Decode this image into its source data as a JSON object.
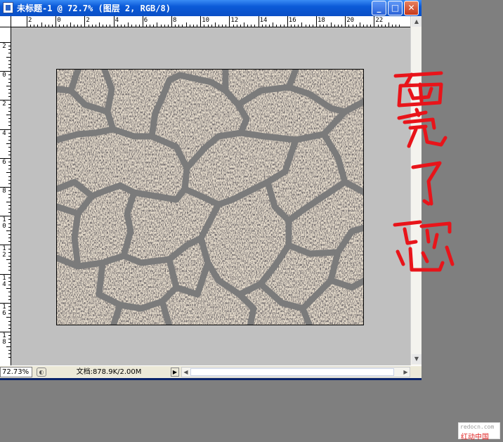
{
  "window": {
    "title": "未标题-1 @ 72.7% (图层 2, RGB/8)",
    "controls": {
      "minimize": "_",
      "maximize": "□",
      "close": "✕"
    }
  },
  "ruler_top": {
    "labels": [
      "2",
      "0",
      "2",
      "4",
      "6",
      "8",
      "10",
      "12",
      "14",
      "16",
      "18",
      "20",
      "22"
    ]
  },
  "ruler_left": {
    "labels": [
      "2",
      "0",
      "2",
      "4",
      "6",
      "8",
      "1\n0",
      "1\n2",
      "1\n4",
      "1\n6",
      "1\n8"
    ]
  },
  "status": {
    "zoom": "72.73%",
    "doc_info": "文档:878.9K/2.00M"
  },
  "annotation": {
    "text": "画完了吧",
    "color": "#e8141a"
  },
  "watermark": {
    "url": "redocn.com",
    "name": "红动中国"
  },
  "colors": {
    "title_bar": "#0b5ad8",
    "canvas_bg": "#c0c0c0",
    "desktop": "#7f7f7f",
    "mortar": "#7b7b7b"
  }
}
